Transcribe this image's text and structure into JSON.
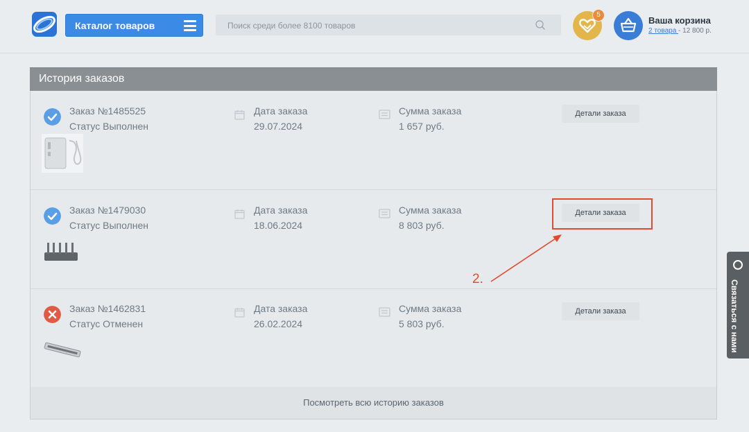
{
  "header": {
    "catalog_label": "Каталог товаров",
    "search_placeholder": "Поиск среди более 8100 товаров",
    "favorites_count": "5",
    "cart_title": "Ваша корзина",
    "cart_items_link": "2 товара ",
    "cart_total": " - 12 800 р."
  },
  "panel": {
    "title": "История заказов",
    "view_all": "Посмотреть всю историю заказов"
  },
  "orders": [
    {
      "number": "Заказ №1485525",
      "status": "Статус Выполнен",
      "status_type": "done",
      "date_label": "Дата заказа",
      "date": "29.07.2024",
      "sum_label": "Сумма заказа",
      "sum": "1 657 руб.",
      "details_label": "Детали заказа",
      "thumb_icon": "charger-product-icon"
    },
    {
      "number": "Заказ №1479030",
      "status": "Статус Выполнен",
      "status_type": "done",
      "date_label": "Дата заказа",
      "date": "18.06.2024",
      "sum_label": "Сумма заказа",
      "sum": "8 803 руб.",
      "details_label": "Детали заказа",
      "thumb_icon": "router-product-icon"
    },
    {
      "number": "Заказ №1462831",
      "status": "Статус Отменен",
      "status_type": "cancelled",
      "date_label": "Дата заказа",
      "date": "26.02.2024",
      "sum_label": "Сумма заказа",
      "sum": "5 803 руб.",
      "details_label": "Детали заказа",
      "thumb_icon": "light-bar-product-icon"
    }
  ],
  "annotation": {
    "step_label": "2."
  },
  "side_tab": {
    "label": "Связаться с нами"
  },
  "colors": {
    "accent_blue": "#3b8ae6",
    "done_status": "#5a9ee6",
    "cancel_status": "#e05a44",
    "annotation_red": "#e2492d",
    "favorites_yellow": "#e2b64a"
  }
}
